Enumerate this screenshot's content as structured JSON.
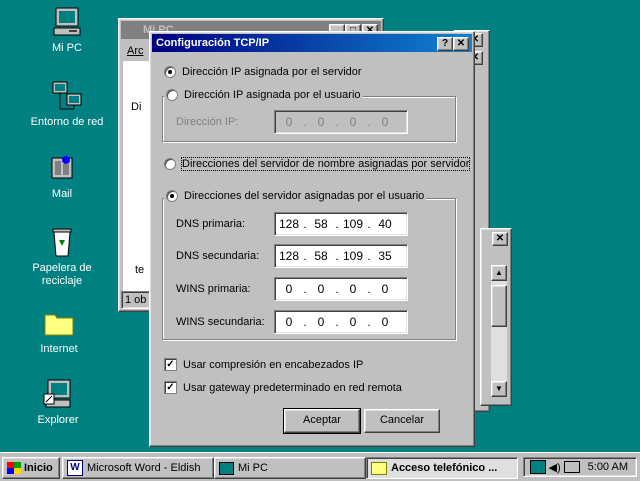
{
  "desktop": {
    "icons": [
      {
        "label": "Mi PC",
        "icon": "my-computer-icon"
      },
      {
        "label": "Entorno de red",
        "icon": "network-neighborhood-icon"
      },
      {
        "label": "Mail",
        "icon": "mail-icon"
      },
      {
        "label": "Papelera de reciclaje",
        "icon": "recycle-bin-icon"
      },
      {
        "label": "Internet",
        "icon": "internet-folder-icon"
      },
      {
        "label": "Explorer",
        "icon": "explorer-icon"
      }
    ]
  },
  "bg_window": {
    "title": "Mi PC",
    "menu_fragment": "Arc",
    "content_fragment_1": "Di",
    "content_fragment_2": "te",
    "status_fragment": "1 ob"
  },
  "dialog": {
    "title": "Configuración TCP/IP",
    "help_button": "?",
    "close_button": "✕",
    "ip_auto": "Dirección IP asignada por el servidor",
    "ip_manual": "Dirección IP asignada por el usuario",
    "ip_label": "Dirección IP:",
    "ip_value": [
      "0",
      "0",
      "0",
      "0"
    ],
    "dns_auto": "Direcciones del servidor de nombre asignadas por servidor",
    "dns_manual": "Direcciones del servidor asignadas por el usuario",
    "dns_primary_label": "DNS primaria:",
    "dns_primary": [
      "128",
      "58",
      "109",
      "40"
    ],
    "dns_secondary_label": "DNS secundaria:",
    "dns_secondary": [
      "128",
      "58",
      "109",
      "35"
    ],
    "wins_primary_label": "WINS primaria:",
    "wins_primary": [
      "0",
      "0",
      "0",
      "0"
    ],
    "wins_secondary_label": "WINS secundaria:",
    "wins_secondary": [
      "0",
      "0",
      "0",
      "0"
    ],
    "compression_label": "Usar compresión en encabezados IP",
    "compression_checked": true,
    "gateway_label": "Usar gateway predeterminado en red remota",
    "gateway_checked": true,
    "ok_label": "Aceptar",
    "cancel_label": "Cancelar"
  },
  "taskbar": {
    "start_label": "Inicio",
    "items": [
      "Microsoft Word - Eldish",
      "Mi PC",
      "Acceso telefónico ..."
    ],
    "clock": "5:00 AM"
  },
  "colors": {
    "desktop": "#008080",
    "title_active": "#000080",
    "title_inactive": "#808080",
    "face": "#c0c0c0"
  }
}
